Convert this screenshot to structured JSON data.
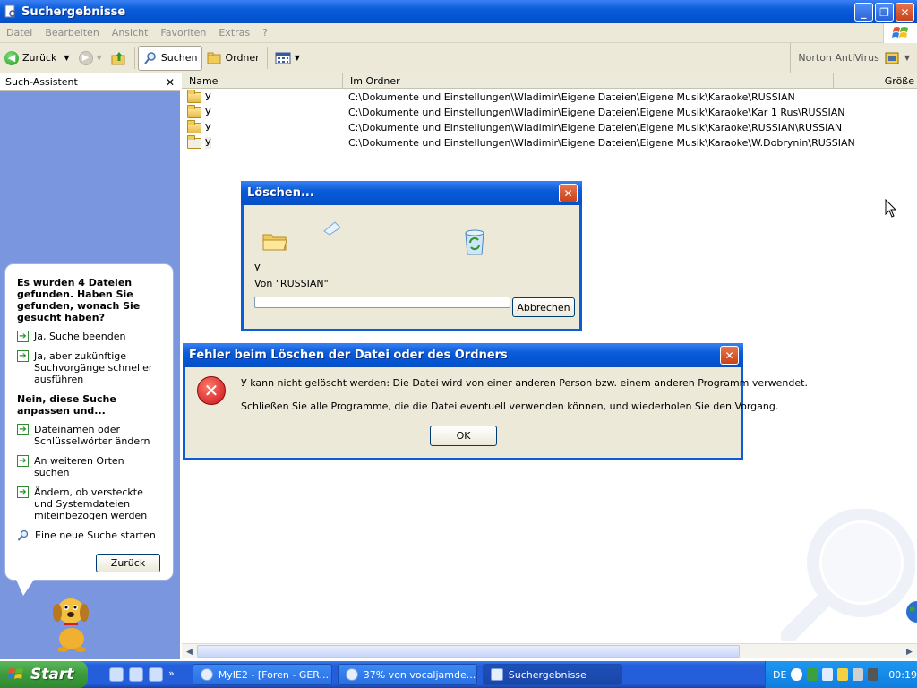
{
  "window": {
    "title": "Suchergebnisse",
    "minimize_label": "_",
    "maximize_label": "❐",
    "close_label": "✕"
  },
  "menubar": {
    "items": [
      "Datei",
      "Bearbeiten",
      "Ansicht",
      "Favoriten",
      "Extras",
      "?"
    ]
  },
  "toolbar": {
    "back_label": "Zurück",
    "search_label": "Suchen",
    "folders_label": "Ordner",
    "norton_label": "Norton AntiVirus"
  },
  "search_pane": {
    "header": "Such-Assistent",
    "close_label": "✕",
    "question": "Es wurden 4 Dateien gefunden. Haben Sie gefunden, wonach Sie gesucht haben?",
    "options_yes": [
      "Ja, Suche beenden",
      "Ja, aber zukünftige Suchvorgänge schneller ausführen"
    ],
    "question2": "Nein, diese Suche anpassen und...",
    "options_no": [
      "Dateinamen oder Schlüsselwörter ändern",
      "An weiteren Orten suchen",
      "Ändern, ob versteckte und Systemdateien miteinbezogen werden"
    ],
    "new_search": "Eine neue Suche starten",
    "back_button": "Zurück"
  },
  "columns": [
    "Name",
    "Im Ordner",
    "Größe"
  ],
  "files": [
    {
      "name": "У",
      "folder": "C:\\Dokumente und Einstellungen\\Wladimir\\Eigene Dateien\\Eigene Musik\\Karaoke\\RUSSIAN"
    },
    {
      "name": "У",
      "folder": "C:\\Dokumente und Einstellungen\\Wladimir\\Eigene Dateien\\Eigene Musik\\Karaoke\\Kar 1 Rus\\RUSSIAN"
    },
    {
      "name": "У",
      "folder": "C:\\Dokumente und Einstellungen\\Wladimir\\Eigene Dateien\\Eigene Musik\\Karaoke\\RUSSIAN\\RUSSIAN"
    },
    {
      "name": "У",
      "folder": "C:\\Dokumente und Einstellungen\\Wladimir\\Eigene Dateien\\Eigene Musik\\Karaoke\\W.Dobrynin\\RUSSIAN"
    }
  ],
  "delete_dialog": {
    "title": "Löschen...",
    "close_label": "✕",
    "item_name": "У",
    "from_text": "Von \"RUSSIAN\"",
    "cancel_button": "Abbrechen"
  },
  "error_dialog": {
    "title": "Fehler beim Löschen der Datei oder des Ordners",
    "close_label": "✕",
    "message1": "У kann nicht gelöscht werden: Die Datei wird von einer anderen Person bzw. einem anderen Programm verwendet.",
    "message2": "Schließen Sie alle Programme, die die Datei eventuell verwenden können, und wiederholen Sie den Vorgang.",
    "ok_button": "OK"
  },
  "taskbar": {
    "start_label": "Start",
    "more_label": "»",
    "tasks": [
      {
        "label": "MyIE2 - [Foren - GER...",
        "active": false
      },
      {
        "label": "37% von vocaljamde...",
        "active": false
      },
      {
        "label": "Suchergebnisse",
        "active": true
      }
    ],
    "lang": "DE",
    "clock": "00:19"
  }
}
